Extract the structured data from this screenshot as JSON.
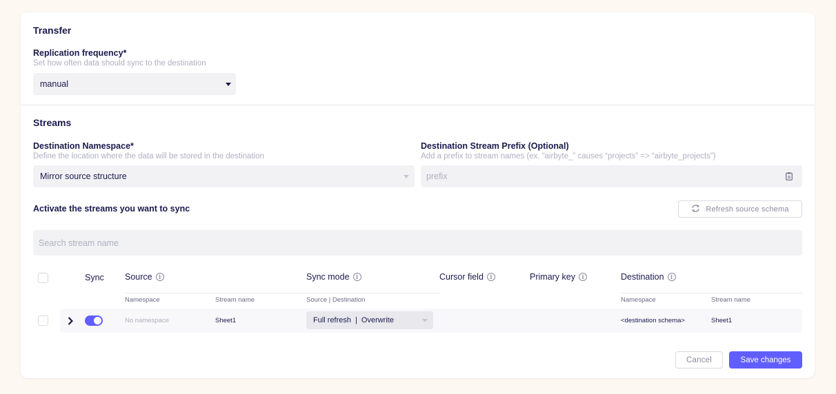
{
  "transfer": {
    "title": "Transfer",
    "frequency_label": "Replication frequency*",
    "frequency_help": "Set how often data should sync to the destination",
    "frequency_value": "manual"
  },
  "streams": {
    "title": "Streams",
    "namespace_label": "Destination Namespace*",
    "namespace_help": "Define the location where the data will be stored in the destination",
    "namespace_value": "Mirror source structure",
    "prefix_label": "Destination Stream Prefix (Optional)",
    "prefix_help": "Add a prefix to stream names (ex. “airbyte_” causes “projects” => “airbyte_projects”)",
    "prefix_placeholder": "prefix",
    "activate_label": "Activate the streams you want to sync",
    "refresh_label": "Refresh source schema",
    "search_placeholder": "Search stream name"
  },
  "table": {
    "headers": {
      "sync": "Sync",
      "source": "Source",
      "sync_mode": "Sync mode",
      "cursor_field": "Cursor field",
      "primary_key": "Primary key",
      "destination": "Destination"
    },
    "subheaders": {
      "source_namespace": "Namespace",
      "source_stream": "Stream name",
      "sync_mode": "Source | Destination",
      "dest_namespace": "Namespace",
      "dest_stream": "Stream name"
    },
    "rows": [
      {
        "source_namespace": "No namespace",
        "source_stream": "Sheet1",
        "sync_source": "Full refresh",
        "sync_separator": "|",
        "sync_dest": "Overwrite",
        "dest_namespace": "<destination schema>",
        "dest_stream": "Sheet1",
        "enabled": true
      }
    ]
  },
  "footer": {
    "cancel_label": "Cancel",
    "save_label": "Save changes"
  },
  "colors": {
    "accent": "#615eff",
    "text": "#1a194d",
    "page_bg": "#fef8f3"
  }
}
